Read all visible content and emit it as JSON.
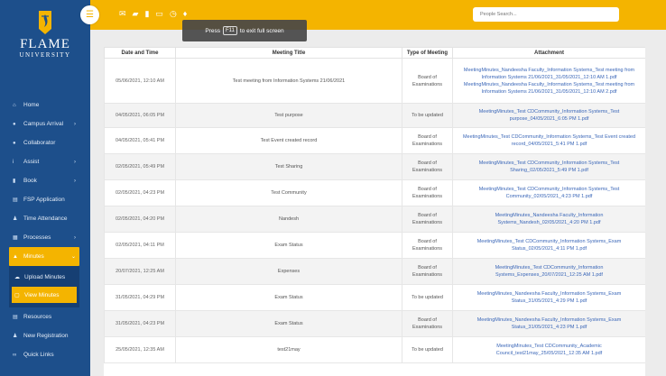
{
  "brand": {
    "name": "FLAME",
    "sub": "UNIVERSITY"
  },
  "colors": {
    "sidebar": "#1d4f8b",
    "accent": "#f4b400",
    "link": "#3b67b8"
  },
  "topbar": {
    "menu_icon": "menu-icon",
    "icons": [
      "mail-icon",
      "graduation-cap-icon",
      "book-icon",
      "monitor-icon",
      "clock-icon",
      "bell-icon"
    ],
    "search_placeholder": "People Search..."
  },
  "fullscreen": {
    "prefix": "Press",
    "key": "F11",
    "suffix": "to exit full screen"
  },
  "sidebar": {
    "items": [
      {
        "label": "Home",
        "icon": "home-icon",
        "has_chevron": false
      },
      {
        "label": "Campus Arrival",
        "icon": "pin-icon",
        "has_chevron": true
      },
      {
        "label": "Collaborator",
        "icon": "people-icon",
        "has_chevron": false
      },
      {
        "label": "Assist",
        "icon": "info-icon",
        "has_chevron": true
      },
      {
        "label": "Book",
        "icon": "book-icon",
        "has_chevron": true
      },
      {
        "label": "FSP Application",
        "icon": "form-icon",
        "has_chevron": false
      },
      {
        "label": "Time Attendance",
        "icon": "user-clock-icon",
        "has_chevron": false
      },
      {
        "label": "Processes",
        "icon": "process-icon",
        "has_chevron": true
      },
      {
        "label": "Minutes",
        "icon": "minutes-icon",
        "has_chevron": true,
        "active": true
      },
      {
        "label": "Resources",
        "icon": "resources-icon",
        "has_chevron": false
      },
      {
        "label": "New Registration",
        "icon": "registration-icon",
        "has_chevron": false
      },
      {
        "label": "Quick Links",
        "icon": "link-icon",
        "has_chevron": false
      }
    ],
    "minutes_submenu": [
      {
        "label": "Upload Minutes",
        "icon": "upload-icon"
      },
      {
        "label": "View Minutes",
        "icon": "view-icon",
        "selected": true
      }
    ]
  },
  "table": {
    "headers": [
      "Date and Time",
      "Meeting Title",
      "Type of Meeting",
      "Attachment"
    ],
    "rows": [
      {
        "date": "05/06/2021, 12:10 AM",
        "title": "Test meeting from Information Systems 21/06/2021",
        "type": "Board of Examinations",
        "attachment": "MeetingMinutes_Nandeesha Faculty_Information Systems_Test meeting from Information Systems 21/06/2021_31/05/2021_12:10 AM 1.pdf MeetingMinutes_Nandeesha Faculty_Information Systems_Test meeting from Information Systems 21/06/2021_31/05/2021_12:10 AM 2.pdf"
      },
      {
        "date": "04/05/2021, 06:05 PM",
        "title": "Test purpose",
        "type": "To be updated",
        "attachment": "MeetingMinutes_Test CDCommunity_Information Systems_Test purpose_04/05/2021_6:05 PM 1.pdf"
      },
      {
        "date": "04/05/2021, 05:41 PM",
        "title": "Test Event created record",
        "type": "Board of Examinations",
        "attachment": "MeetingMinutes_Test CDCommunity_Information Systems_Test Event created record_04/05/2021_5:41 PM 1.pdf"
      },
      {
        "date": "02/05/2021, 05:49 PM",
        "title": "Test Sharing",
        "type": "Board of Examinations",
        "attachment": "MeetingMinutes_Test CDCommunity_Information Systems_Test Sharing_02/05/2021_5:49 PM 1.pdf"
      },
      {
        "date": "02/05/2021, 04:23 PM",
        "title": "Test Community",
        "type": "Board of Examinations",
        "attachment": "MeetingMinutes_Test CDCommunity_Information Systems_Test Community_02/05/2021_4:23 PM 1.pdf"
      },
      {
        "date": "02/05/2021, 04:20 PM",
        "title": "Nandesh",
        "type": "Board of Examinations",
        "attachment": "MeetingMinutes_Nandeesha Faculty_Information Systems_Nandesh_02/05/2021_4:20 PM 1.pdf"
      },
      {
        "date": "02/05/2021, 04:11 PM",
        "title": "Exam Status",
        "type": "Board of Examinations",
        "attachment": "MeetingMinutes_Test CDCommunity_Information Systems_Exam Status_02/05/2021_4:11 PM 1.pdf"
      },
      {
        "date": "20/07/2021, 12:25 AM",
        "title": "Expenses",
        "type": "Board of Examinations",
        "attachment": "MeetingMinutes_Test CDCommunity_Information Systems_Expenses_20/07/2021_12:25 AM 1.pdf"
      },
      {
        "date": "31/05/2021, 04:29 PM",
        "title": "Exam Status",
        "type": "To be updated",
        "attachment": "MeetingMinutes_Nandeesha Faculty_Information Systems_Exam Status_31/05/2021_4:29 PM 1.pdf"
      },
      {
        "date": "31/05/2021, 04:23 PM",
        "title": "Exam Status",
        "type": "Board of Examinations",
        "attachment": "MeetingMinutes_Nandeesha Faculty_Information Systems_Exam Status_31/05/2021_4:23 PM 1.pdf"
      },
      {
        "date": "25/05/2021, 12:35 AM",
        "title": "test21may",
        "type": "To be updated",
        "attachment": "MeetingMinutes_Test CDCommunity_Academic Council_test21may_25/05/2021_12:35 AM 1.pdf"
      }
    ]
  }
}
